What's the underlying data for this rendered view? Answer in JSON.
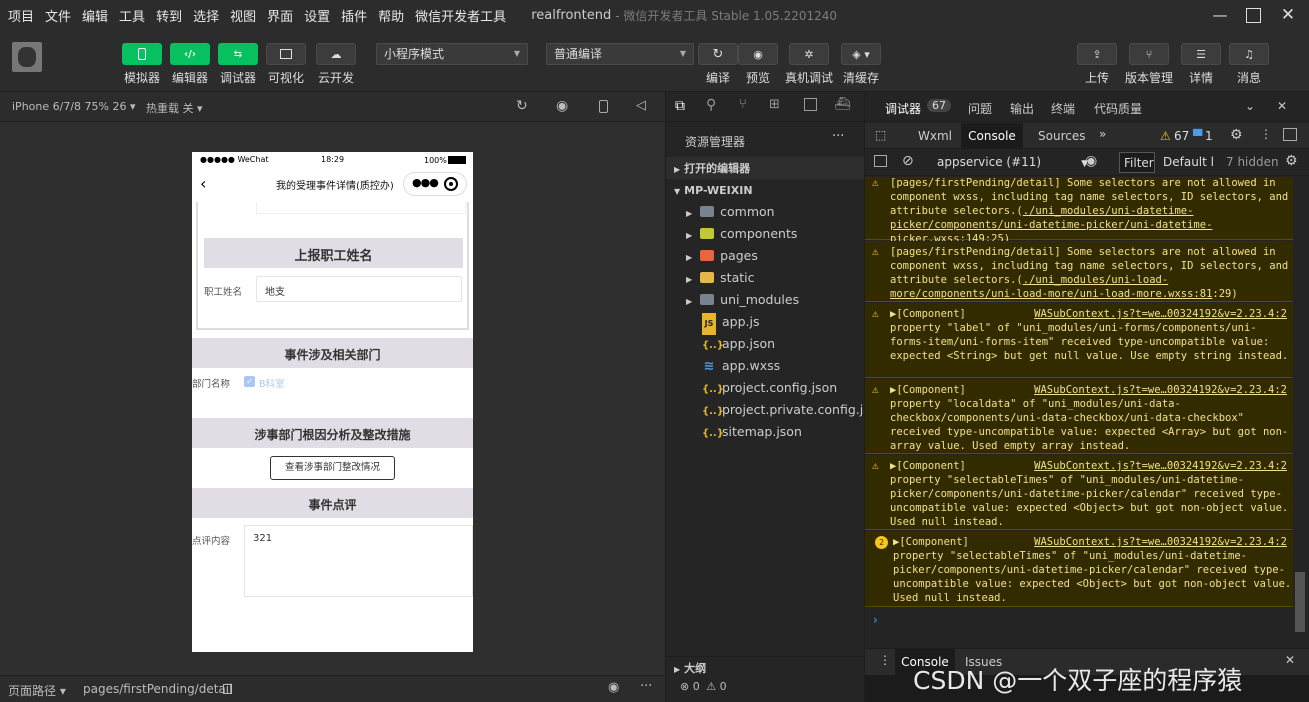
{
  "menubar": {
    "items": [
      "项目",
      "文件",
      "编辑",
      "工具",
      "转到",
      "选择",
      "视图",
      "界面",
      "设置",
      "插件",
      "帮助",
      "微信开发者工具"
    ],
    "project": "realfrontend",
    "app_title": "- 微信开发者工具 Stable 1.05.2201240"
  },
  "toolbar": {
    "left_buttons": [
      "模拟器",
      "编辑器",
      "调试器",
      "可视化",
      "云开发"
    ],
    "mode_select": "小程序模式",
    "compile_select": "普通编译",
    "mid_buttons": [
      "编译",
      "预览",
      "真机调试",
      "清缓存"
    ],
    "right_buttons": [
      "上传",
      "版本管理",
      "详情",
      "消息"
    ]
  },
  "simulator": {
    "device": "iPhone 6/7/8 75% 26",
    "hot_reload": "热重载 关",
    "status_bar": {
      "carrier": "●●●●● WeChat",
      "time": "18:29",
      "battery": "100%"
    },
    "nav_title": "我的受理事件详情(质控办)",
    "sections": {
      "report_name_title": "上报职工姓名",
      "name_label": "职工姓名",
      "name_value": "地支",
      "dept_title": "事件涉及相关部门",
      "dept_label": "部门名称",
      "dept_value": "B科室",
      "analysis_title": "涉事部门根因分析及整改措施",
      "analysis_button": "查看涉事部门整改情况",
      "review_title": "事件点评",
      "review_label": "点评内容",
      "review_value": "321"
    }
  },
  "status_bar": {
    "path_label": "页面路径",
    "path": "pages/firstPending/detail"
  },
  "explorer": {
    "title": "资源管理器",
    "open_editors": "打开的编辑器",
    "root": "MP-WEIXIN",
    "folders": [
      "common",
      "components",
      "pages",
      "static",
      "uni_modules"
    ],
    "files": [
      "app.js",
      "app.json",
      "app.wxss",
      "project.config.json",
      "project.private.config.js...",
      "sitemap.json"
    ],
    "outline": "大纲",
    "errors": "0",
    "warnings": "0"
  },
  "devtools": {
    "title": "调试器",
    "badge": "67",
    "tabs": [
      "问题",
      "输出",
      "终端",
      "代码质量"
    ],
    "panel_tabs": [
      "Wxml",
      "Console",
      "Sources"
    ],
    "warn_count": "67",
    "info_count": "1",
    "context": "appservice (#11)",
    "filter": "Filter",
    "levels": "Default l",
    "hidden": "7 hidden",
    "messages": [
      {
        "text": "[pages/firstPending/detail] Some selectors are not allowed in component wxss, including tag name selectors, ID selectors, and attribute selectors.(",
        "link": "./uni_modules/uni-datetime-picker/components/uni-datetime-picker/uni-datetime-picker.wxss:149",
        "tail": ":25)"
      },
      {
        "text": "[pages/firstPending/detail] Some selectors are not allowed in component wxss, including tag name selectors, ID selectors, and attribute selectors.(",
        "link": "./uni_modules/uni-load-more/components/uni-load-more/uni-load-more.wxss:81",
        "tail": ":29)"
      },
      {
        "head": "▶[Component]",
        "src": "WASubContext.js?t=we…00324192&v=2.23.4:2",
        "text": "property \"label\" of \"uni_modules/uni-forms/components/uni-forms-item/uni-forms-item\" received type-uncompatible value: expected <String> but get null value. Use empty string instead."
      },
      {
        "head": "▶[Component]",
        "src": "WASubContext.js?t=we…00324192&v=2.23.4:2",
        "text": "property \"localdata\" of \"uni_modules/uni-data-checkbox/components/uni-data-checkbox/uni-data-checkbox\" received type-uncompatible value: expected <Array> but got non-array value. Used empty array instead."
      },
      {
        "head": "▶[Component]",
        "src": "WASubContext.js?t=we…00324192&v=2.23.4:2",
        "text": "property \"selectableTimes\" of \"uni_modules/uni-datetime-picker/components/uni-datetime-picker/calendar\" received type-uncompatible value: expected <Object> but got non-object value. Used null instead."
      },
      {
        "count": "2",
        "head": "▶[Component]",
        "src": "WASubContext.js?t=we…00324192&v=2.23.4:2",
        "text": "property \"selectableTimes\" of \"uni_modules/uni-datetime-picker/components/uni-datetime-picker/calendar\" received type-uncompatible value: expected <Object> but got non-object value. Used null instead."
      }
    ],
    "drawer_tabs": [
      "Console",
      "Issues"
    ]
  },
  "watermark": "CSDN @一个双子座的程序猿"
}
